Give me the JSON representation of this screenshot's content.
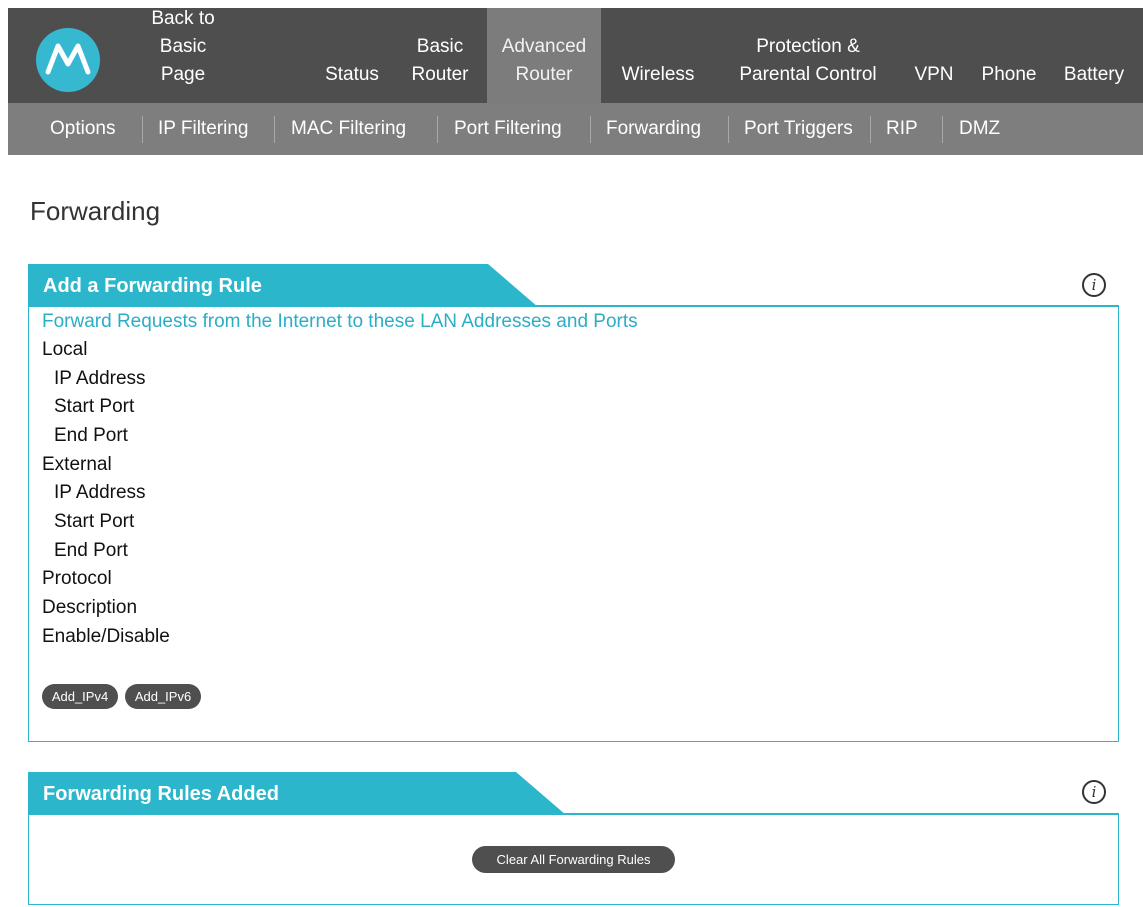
{
  "nav": {
    "items": [
      {
        "line1": "Back to",
        "line2": "Basic Page"
      },
      {
        "line1": "",
        "line2": "Status"
      },
      {
        "line1": "Basic",
        "line2": "Router"
      },
      {
        "line1": "Advanced",
        "line2": "Router"
      },
      {
        "line1": "",
        "line2": "Wireless"
      },
      {
        "line1": "Protection &",
        "line2": "Parental Control"
      },
      {
        "line1": "",
        "line2": "VPN"
      },
      {
        "line1": "",
        "line2": "Phone"
      },
      {
        "line1": "",
        "line2": "Battery"
      }
    ],
    "active": "Advanced Router"
  },
  "subnav": {
    "items": [
      "Options",
      "IP Filtering",
      "MAC Filtering",
      "Port Filtering",
      "Forwarding",
      "Port Triggers",
      "RIP",
      "DMZ"
    ],
    "active": "Forwarding"
  },
  "page": {
    "title": "Forwarding"
  },
  "add_rule": {
    "title": "Add a Forwarding Rule",
    "section_heading": "Forward Requests from the Internet to these LAN Addresses and Ports",
    "fields": [
      "Local",
      "IP Address",
      "Start Port",
      "End Port",
      "External",
      "IP Address",
      "Start Port",
      "End Port",
      "Protocol",
      "Description",
      "Enable/Disable"
    ],
    "buttons": {
      "add_ipv4": "Add_IPv4",
      "add_ipv6": "Add_IPv6"
    }
  },
  "rules_added": {
    "title": "Forwarding Rules Added",
    "clear_button": "Clear All Forwarding Rules"
  },
  "colors": {
    "topbar": "#4e4e4e",
    "subbar": "#7e7e7e",
    "accent": "#2bb6cc",
    "logo": "#35b8d0",
    "pill": "#4f4f4f"
  },
  "icons": {
    "logo": "motorola-logo-icon",
    "info": "info-icon"
  }
}
